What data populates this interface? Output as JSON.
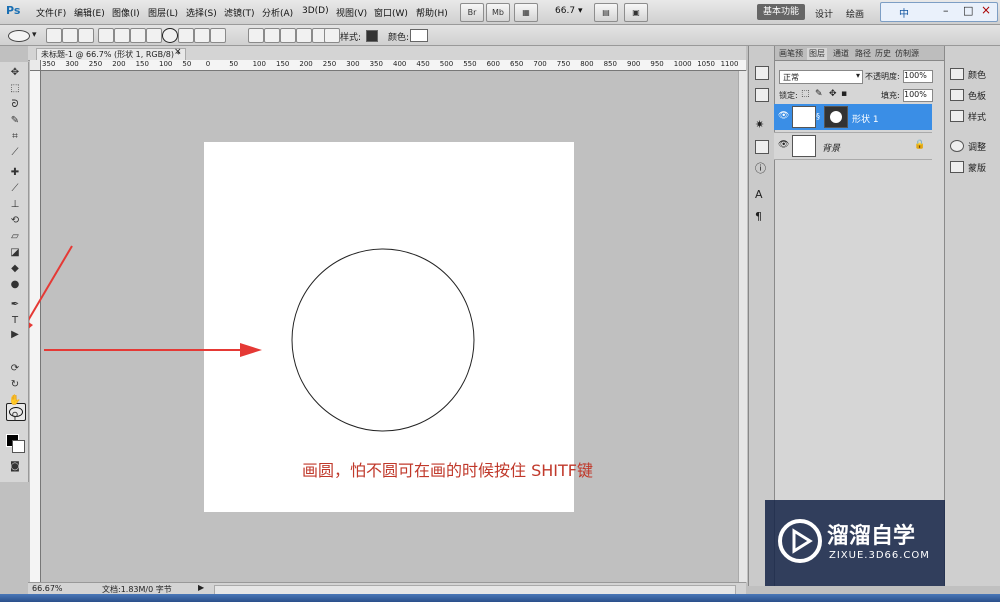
{
  "app": {
    "logo": "Ps"
  },
  "menu": [
    "文件(F)",
    "编辑(E)",
    "图像(I)",
    "图层(L)",
    "选择(S)",
    "滤镜(T)",
    "分析(A)",
    "3D(D)",
    "视图(V)",
    "窗口(W)",
    "帮助(H)"
  ],
  "zoom_combo": "66.7",
  "workspaces": {
    "active": "基本功能",
    "others": [
      "设计",
      "绘画"
    ]
  },
  "window_controls": {
    "ime": "中",
    "minimize": "–",
    "restore": "□",
    "close": "×"
  },
  "options_bar": {
    "style_label": "样式:",
    "color_label": "颜色:",
    "color_value": "#ffffff",
    "style_swatch": "#333333"
  },
  "document": {
    "tab_title": "未标题-1 @ 66.7% (形状 1, RGB/8) *",
    "tab_close": "×",
    "ruler_h": [
      "350",
      "300",
      "250",
      "200",
      "150",
      "100",
      "50",
      "0",
      "50",
      "100",
      "150",
      "200",
      "250",
      "300",
      "350",
      "400",
      "450",
      "500",
      "550",
      "600",
      "650",
      "700",
      "750",
      "800",
      "850",
      "900",
      "950",
      "1000",
      "1050",
      "1100"
    ],
    "annotation": "画圆，怕不圆可在画的时候按住 SHITF键",
    "annotation_color": "#c0392b"
  },
  "status": {
    "zoom": "66.67%",
    "doc_size": "文档:1.83M/0 字节"
  },
  "layers_panel": {
    "tabs": [
      "画笔预",
      "图层",
      "通道",
      "路径",
      "历史",
      "仿制源"
    ],
    "blend_mode": "正常",
    "opacity_label": "不透明度:",
    "opacity": "100%",
    "lock_label": "锁定:",
    "fill_label": "填充:",
    "fill": "100%",
    "layers": [
      {
        "name": "形状 1",
        "selected": true
      },
      {
        "name": "背景",
        "selected": false
      }
    ]
  },
  "right_strip": {
    "items": [
      "颜色",
      "色板",
      "样式",
      "调整",
      "蒙版"
    ]
  },
  "watermark": {
    "title": "溜溜自学",
    "subtitle": "ZIXUE.3D66.COM"
  },
  "colors": {
    "selection_blue": "#3a8ee6",
    "arrow_red": "#e53935"
  }
}
